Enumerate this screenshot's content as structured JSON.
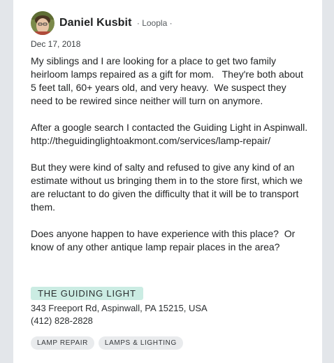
{
  "post": {
    "author": "Daniel Kusbit",
    "meta": " · Loopla · ",
    "date": "Dec 17, 2018",
    "paragraphs": [
      "My siblings and I are looking for a place to get two family heirloom lamps repaired as a gift for mom.   They're both about 5 feet tall, 60+ years old, and very heavy.  We suspect they need to be rewired since neither will turn on anymore.",
      "After a google search I contacted the Guiding Light in Aspinwall.  http://theguidinglightoakmont.com/services/lamp-repair/",
      "But they were kind of salty and refused to give any kind of an estimate without us bringing them in to the store first, which we are reluctant to do given the difficulty that it will be to transport them.",
      "Does anyone happen to have experience with this place?  Or know of any other antique lamp repair places in the area?"
    ]
  },
  "place": {
    "name": "THE GUIDING LIGHT",
    "address": "343 Freeport Rd, Aspinwall, PA 15215, USA",
    "phone": "(412) 828-2828"
  },
  "tags": [
    "LAMP REPAIR",
    "LAMPS & LIGHTING"
  ],
  "colors": {
    "background": "#e3e6ea",
    "card": "#ffffff",
    "place_tag": "#cbece3",
    "chip": "#e9ebed"
  },
  "icons": {
    "avatar": "user-avatar"
  }
}
